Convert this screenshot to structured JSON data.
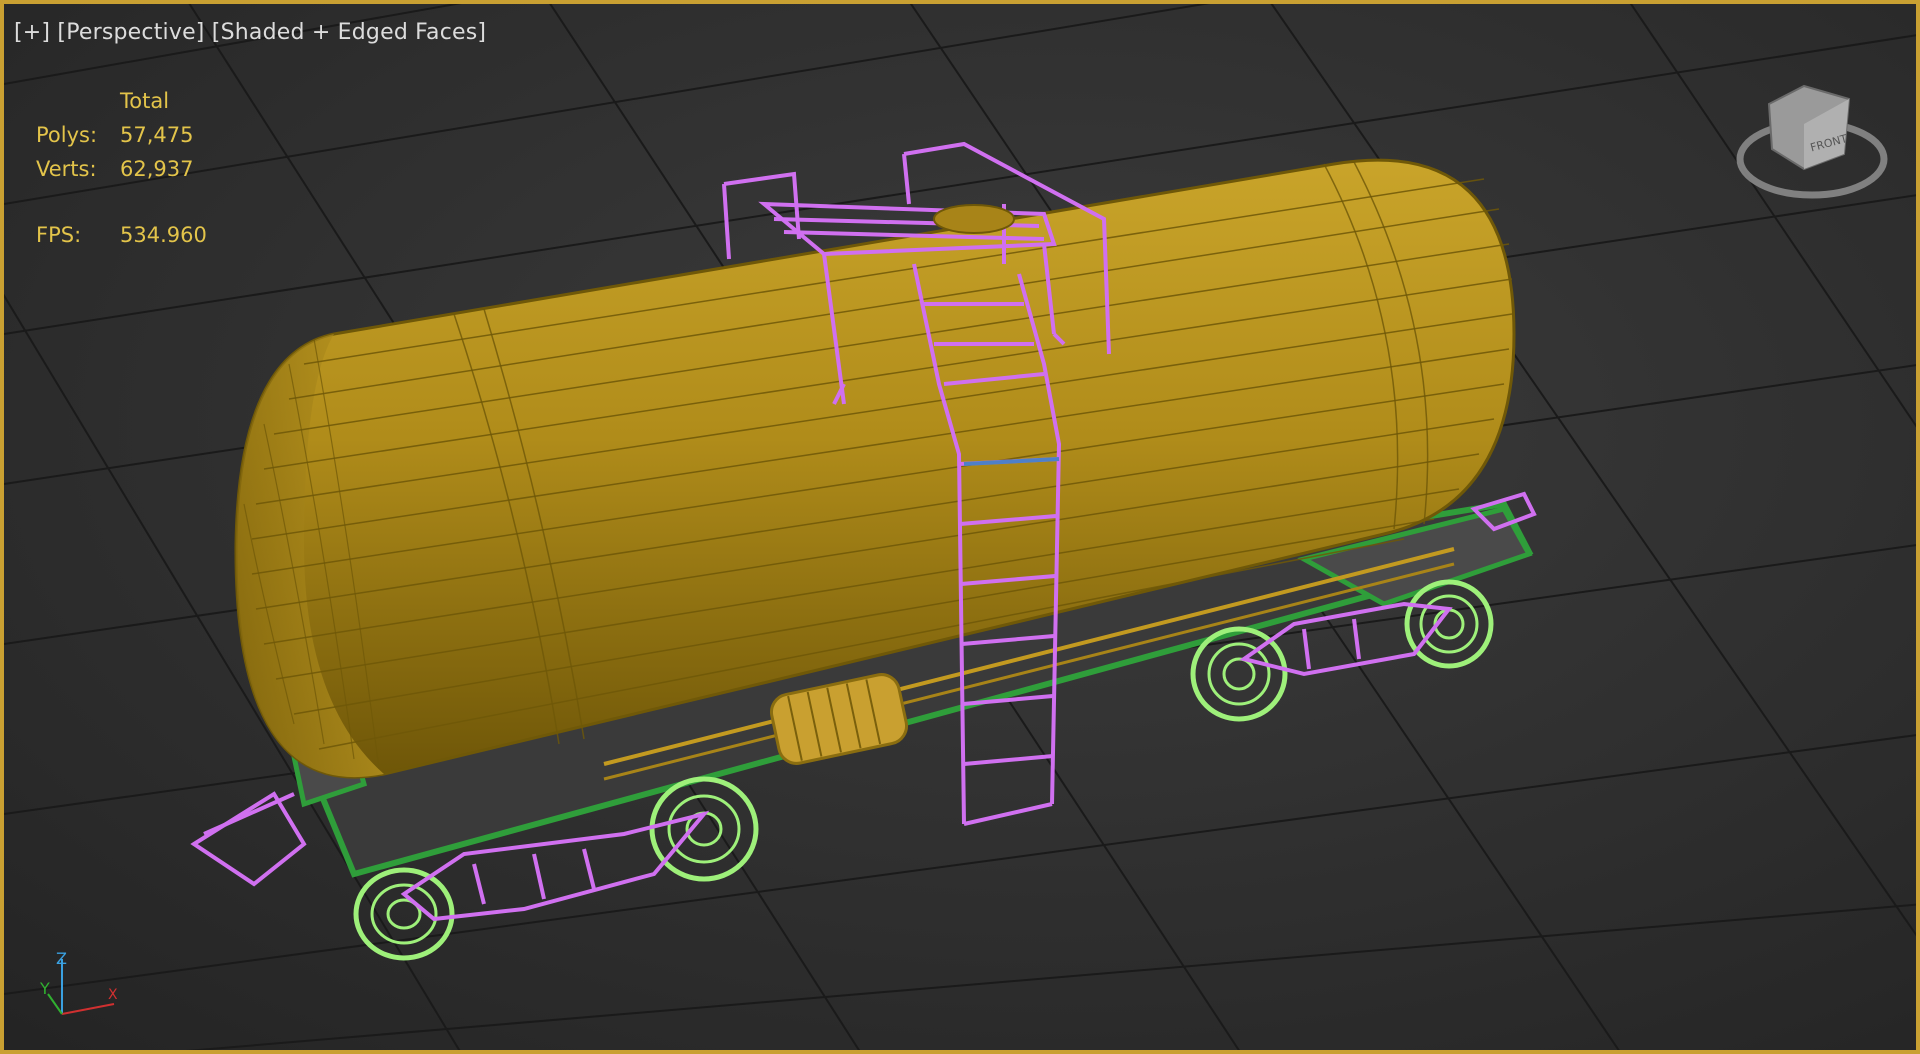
{
  "viewport": {
    "menu_plus": "[+]",
    "view_mode": "[Perspective]",
    "shading_mode": "[Shaded + Edged Faces]"
  },
  "stats": {
    "header": "Total",
    "polys_label": "Polys:",
    "polys_value": "57,475",
    "verts_label": "Verts:",
    "verts_value": "62,937",
    "fps_label": "FPS:",
    "fps_value": "534.960"
  },
  "viewcube": {
    "face_label": "FRONT"
  },
  "axis_gizmo": {
    "x": "X",
    "y": "Y",
    "z": "Z"
  },
  "colors": {
    "viewport_border": "#c9a032",
    "grid": "#1c1c1c",
    "tank": "#b08c1a",
    "tank_wire": "#6f5808",
    "rail_frame": "#2f9e3a",
    "ladder_wire": "#d070f0",
    "wheels": "#9ef07a",
    "stats_text": "#e3c44a"
  }
}
